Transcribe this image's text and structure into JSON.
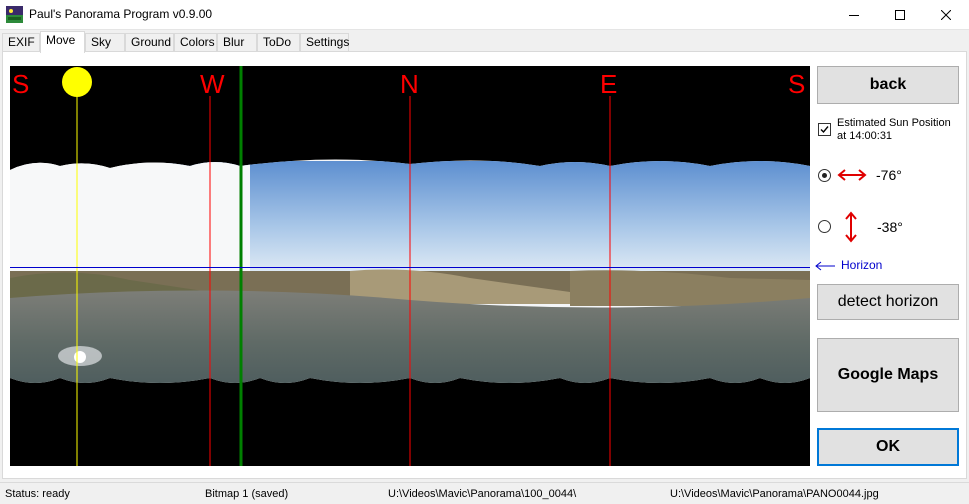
{
  "window": {
    "title": "Paul's Panorama Program v0.9.00"
  },
  "tabs": [
    {
      "label": "EXIF"
    },
    {
      "label": "Move"
    },
    {
      "label": "Sky"
    },
    {
      "label": "Ground"
    },
    {
      "label": "Colors"
    },
    {
      "label": "Blur"
    },
    {
      "label": "ToDo"
    },
    {
      "label": "Settings"
    }
  ],
  "viewer": {
    "directions": [
      "S",
      "W",
      "N",
      "E",
      "S"
    ],
    "horizon_label": "Horizon"
  },
  "controls": {
    "back_label": "back",
    "sun_checkbox_label": "Estimated Sun Position at 14:00:31",
    "sun_checked": true,
    "horizontal_angle": "-76°",
    "vertical_angle": "-38°",
    "detect_horizon_label": "detect horizon",
    "google_maps_label": "Google Maps",
    "ok_label": "OK"
  },
  "status": {
    "state": "Status: ready",
    "bitmap": "Bitmap 1 (saved)",
    "folder": "U:\\Videos\\Mavic\\Panorama\\100_0044\\",
    "file": "U:\\Videos\\Mavic\\Panorama\\PANO0044.jpg"
  },
  "colors": {
    "direction_lines": "#ff0000",
    "sun": "#ffff00",
    "center_line": "#008000",
    "horizon_line": "#0000cc",
    "accent": "#0078d7"
  }
}
